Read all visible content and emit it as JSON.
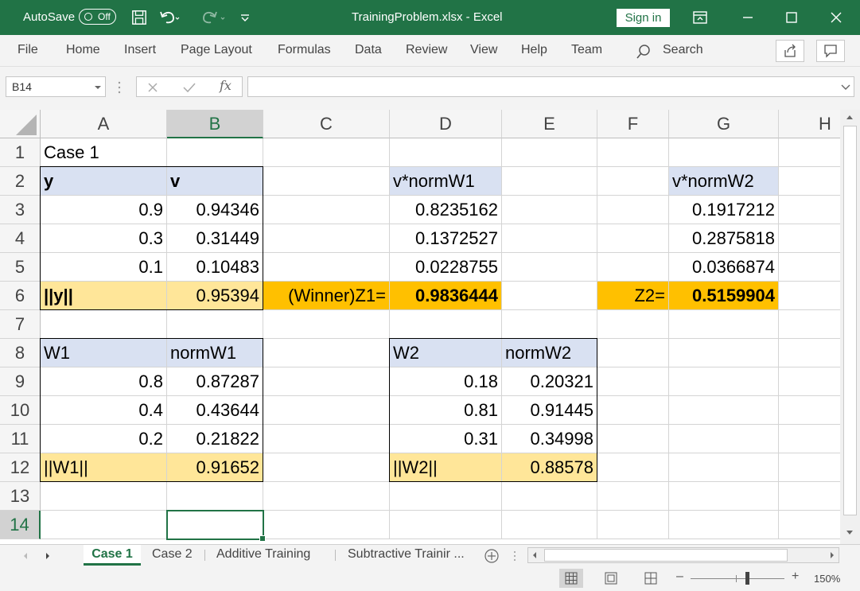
{
  "titlebar": {
    "autosave_label": "AutoSave",
    "autosave_state": "Off",
    "title": "TrainingProblem.xlsx  -  Excel",
    "signin": "Sign in"
  },
  "ribbon": {
    "tabs": [
      "File",
      "Home",
      "Insert",
      "Page Layout",
      "Formulas",
      "Data",
      "Review",
      "View",
      "Help",
      "Team"
    ],
    "search": "Search"
  },
  "formula_bar": {
    "name_box": "B14",
    "fx": "fx",
    "content": ""
  },
  "columns": [
    "A",
    "B",
    "C",
    "D",
    "E",
    "F",
    "G",
    "H"
  ],
  "selected_column": "B",
  "rows": [
    "1",
    "2",
    "3",
    "4",
    "5",
    "6",
    "7",
    "8",
    "9",
    "10",
    "11",
    "12",
    "13",
    "14"
  ],
  "selected_row": "14",
  "cells": {
    "A1": "Case 1",
    "A2": "y",
    "B2": "v",
    "A3": "0.9",
    "B3": "0.94346",
    "A4": "0.3",
    "B4": "0.31449",
    "A5": "0.1",
    "B5": "0.10483",
    "A6": "||y||",
    "B6": "0.95394",
    "C6": "(Winner)Z1=",
    "D6": "0.9836444",
    "D2": "v*normW1",
    "D3": "0.8235162",
    "D4": "0.1372527",
    "D5": "0.0228755",
    "G2": "v*normW2",
    "G3": "0.1917212",
    "G4": "0.2875818",
    "G5": "0.0366874",
    "F6": "Z2=",
    "G6": "0.5159904",
    "A8": "W1",
    "B8": "normW1",
    "A9": "0.8",
    "B9": "0.87287",
    "A10": "0.4",
    "B10": "0.43644",
    "A11": "0.2",
    "B11": "0.21822",
    "A12": "||W1||",
    "B12": "0.91652",
    "D8": "W2",
    "E8": "normW2",
    "D9": "0.18",
    "E9": "0.20321",
    "D10": "0.81",
    "E10": "0.91445",
    "D11": "0.31",
    "E11": "0.34998",
    "D12": "||W2||",
    "E12": "0.88578"
  },
  "sheets": [
    "Case 1",
    "Case 2",
    "Additive Training",
    "Subtractive Trainir ..."
  ],
  "active_sheet": "Case 1",
  "status": {
    "zoom": "150%"
  },
  "colors": {
    "accent": "#217346",
    "header_fill": "#d9e1f2",
    "total_fill": "#ffe699",
    "winner_fill": "#ffc000"
  }
}
